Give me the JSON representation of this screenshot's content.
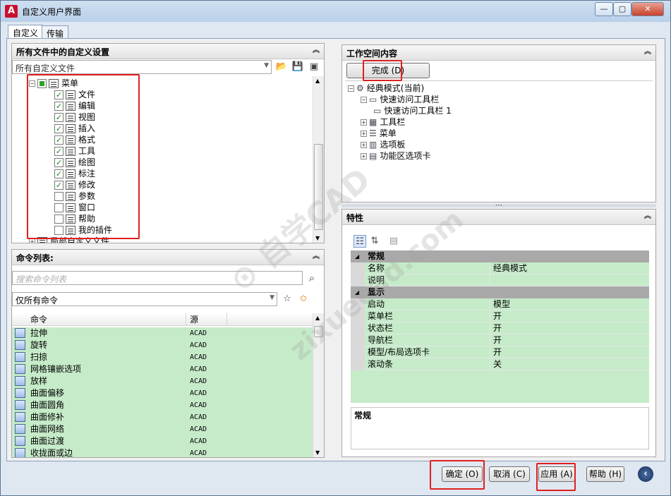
{
  "window": {
    "title": "自定义用户界面",
    "app_icon_letter": "A",
    "controls": [
      "minimize",
      "maximize",
      "close"
    ]
  },
  "tabs": [
    {
      "label": "自定义",
      "active": true
    },
    {
      "label": "传输",
      "active": false
    }
  ],
  "left_top_panel": {
    "header": "所有文件中的自定义设置",
    "file_combo": "所有自定义文件",
    "tree": {
      "root": "菜单",
      "items": [
        {
          "label": "文件",
          "checked": true
        },
        {
          "label": "编辑",
          "checked": true
        },
        {
          "label": "视图",
          "checked": true
        },
        {
          "label": "插入",
          "checked": true
        },
        {
          "label": "格式",
          "checked": true
        },
        {
          "label": "工具",
          "checked": true
        },
        {
          "label": "绘图",
          "checked": true
        },
        {
          "label": "标注",
          "checked": true
        },
        {
          "label": "修改",
          "checked": true
        },
        {
          "label": "参数",
          "checked": false
        },
        {
          "label": "窗口",
          "checked": false
        },
        {
          "label": "帮助",
          "checked": false
        },
        {
          "label": "我的插件",
          "checked": false
        }
      ],
      "partial_last": "局部自定义文件"
    }
  },
  "command_panel": {
    "header": "命令列表:",
    "search_placeholder": "搜索命令列表",
    "filter_combo": "仅所有命令",
    "columns": [
      "命令",
      "源"
    ],
    "rows": [
      {
        "name": "拉伸",
        "source": "ACAD"
      },
      {
        "name": "旋转",
        "source": "ACAD"
      },
      {
        "name": "扫掠",
        "source": "ACAD"
      },
      {
        "name": "网格镶嵌选项",
        "source": "ACAD"
      },
      {
        "name": "放样",
        "source": "ACAD"
      },
      {
        "name": "曲面偏移",
        "source": "ACAD"
      },
      {
        "name": "曲面圆角",
        "source": "ACAD"
      },
      {
        "name": "曲面修补",
        "source": "ACAD"
      },
      {
        "name": "曲面网络",
        "source": "ACAD"
      },
      {
        "name": "曲面过渡",
        "source": "ACAD"
      },
      {
        "name": "收拢面或边",
        "source": "ACAD"
      }
    ]
  },
  "workspace_panel": {
    "header": "工作空间内容",
    "done_button": "完成 (D)",
    "tree": [
      {
        "label": "经典模式(当前)",
        "level": 0
      },
      {
        "label": "快速访问工具栏",
        "level": 1
      },
      {
        "label": "快速访问工具栏 1",
        "level": 2
      },
      {
        "label": "工具栏",
        "level": 1
      },
      {
        "label": "菜单",
        "level": 1
      },
      {
        "label": "选项板",
        "level": 1
      },
      {
        "label": "功能区选项卡",
        "level": 1
      }
    ]
  },
  "properties_panel": {
    "header": "特性",
    "categories": [
      {
        "name": "常规",
        "rows": [
          {
            "key": "名称",
            "value": "经典模式"
          },
          {
            "key": "说明",
            "value": ""
          }
        ]
      },
      {
        "name": "显示",
        "rows": [
          {
            "key": "启动",
            "value": "模型"
          },
          {
            "key": "菜单栏",
            "value": "开"
          },
          {
            "key": "状态栏",
            "value": "开"
          },
          {
            "key": "导航栏",
            "value": "开"
          },
          {
            "key": "模型/布局选项卡",
            "value": "开"
          },
          {
            "key": "滚动条",
            "value": "关"
          }
        ]
      }
    ],
    "description_title": "常规"
  },
  "footer": {
    "ok": "确定 (O)",
    "cancel": "取消 (C)",
    "apply": "应用 (A)",
    "help": "帮助 (H)"
  },
  "colors": {
    "highlight_row": "#c6ebc9",
    "annotation_red": "#e02020",
    "titlebar": "#b9d0ea"
  }
}
